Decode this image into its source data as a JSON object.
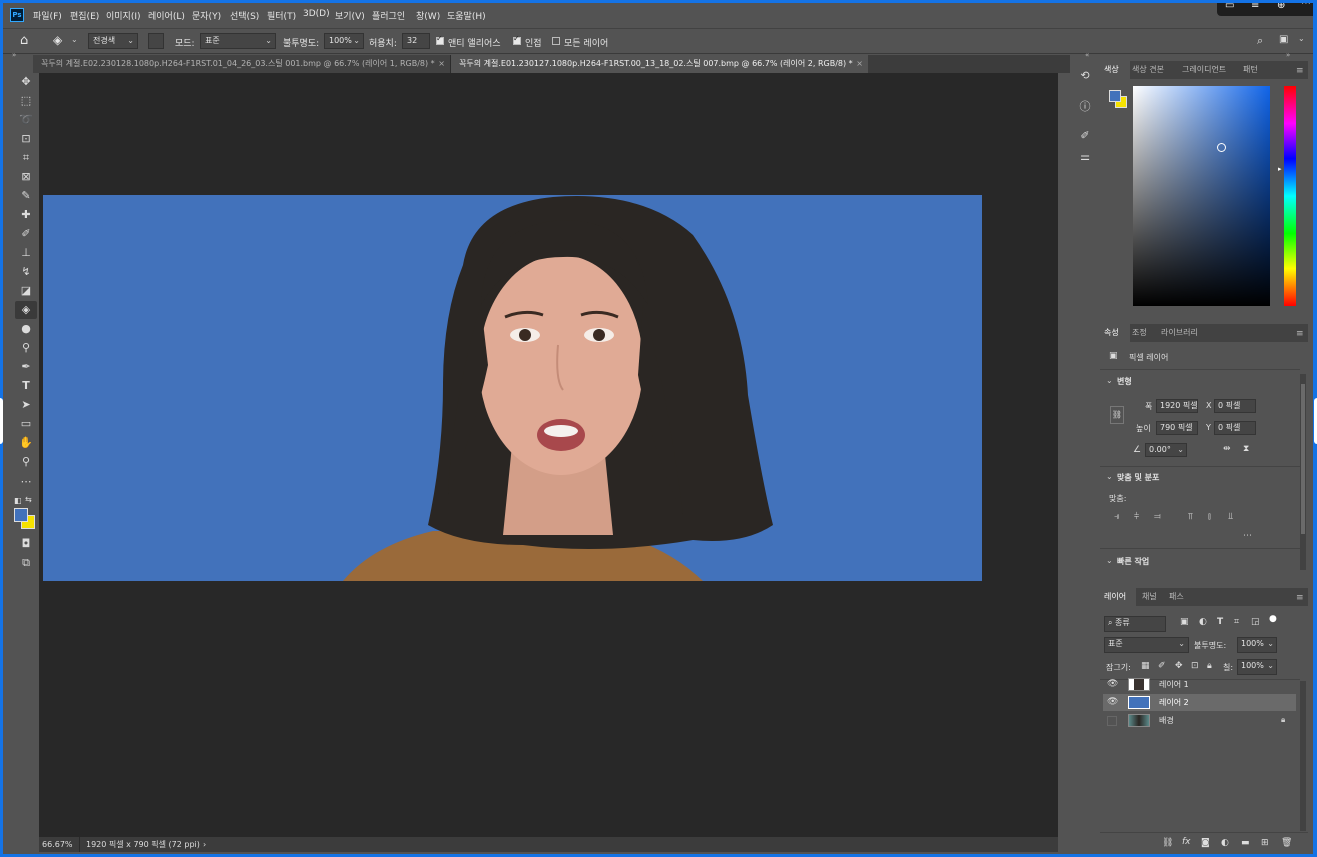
{
  "app": {
    "logo": "Ps"
  },
  "menu": [
    "파일(F)",
    "편집(E)",
    "이미지(I)",
    "레이어(L)",
    "문자(Y)",
    "선택(S)",
    "필터(T)",
    "3D(D)",
    "보기(V)",
    "플러그인",
    "창(W)",
    "도움말(H)"
  ],
  "options": {
    "fill_source": "전경색",
    "mode_label": "모드:",
    "mode_value": "표준",
    "opacity_label": "불투명도:",
    "opacity_value": "100%",
    "tolerance_label": "허용치:",
    "tolerance_value": "32",
    "antialias_label": "앤티 앨리어스",
    "antialias_checked": true,
    "contiguous_label": "인접",
    "contiguous_checked": true,
    "all_layers_label": "모든 레이어",
    "all_layers_checked": false
  },
  "doc_tabs": [
    {
      "label": "꼭두의 계절.E02.230128.1080p.H264-F1RST.01_04_26_03.스틸 001.bmp @ 66.7% (레이어 1, RGB/8) *",
      "active": false
    },
    {
      "label": "꼭두의 계절.E01.230127.1080p.H264-F1RST.00_13_18_02.스틸 007.bmp @ 66.7% (레이어 2, RGB/8) *",
      "active": true
    }
  ],
  "canvas": {
    "background_color": "#4272bb"
  },
  "status": {
    "zoom": "66.67%",
    "doc_size": "1920 픽셀 x 790 픽셀 (72 ppi)"
  },
  "colors": {
    "foreground": "#4272bb",
    "background": "#f5e100"
  },
  "color_panel": {
    "tabs": [
      "색상",
      "색상 견본",
      "그레이디언트",
      "패턴"
    ],
    "active": 0
  },
  "props_panel": {
    "tabs": [
      "속성",
      "조정",
      "라이브러리"
    ],
    "layer_type": "픽셀 레이어",
    "transform_title": "변형",
    "w_label": "폭",
    "w_value": "1920 픽셀",
    "h_label": "높이",
    "h_value": "790 픽셀",
    "x_label": "X",
    "x_value": "0 픽셀",
    "y_label": "Y",
    "y_value": "0 픽셀",
    "angle_value": "0.00°",
    "align_title": "맞춤 및 분포",
    "align_label": "맞춤:",
    "quick_actions_title": "빠른 작업"
  },
  "layers_panel": {
    "tabs": [
      "레이어",
      "채널",
      "패스"
    ],
    "filter_label": "종류",
    "blend_mode": "표준",
    "opacity_label": "불투명도:",
    "opacity_value": "100%",
    "lock_label": "잠그기:",
    "fill_label": "칠:",
    "fill_value": "100%",
    "layers": [
      {
        "name": "레이어 1",
        "visible": true,
        "selected": false,
        "thumb": "portrait-cutout"
      },
      {
        "name": "레이어 2",
        "visible": true,
        "selected": true,
        "thumb": "blue-fill"
      },
      {
        "name": "배경",
        "visible": false,
        "selected": false,
        "thumb": "photo",
        "locked": true
      }
    ]
  }
}
